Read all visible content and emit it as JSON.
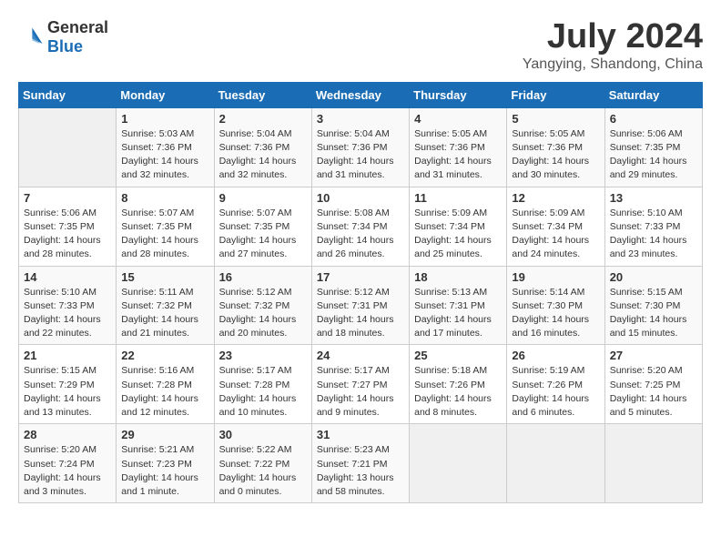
{
  "logo": {
    "line1": "General",
    "line2": "Blue"
  },
  "title": "July 2024",
  "location": "Yangying, Shandong, China",
  "headers": [
    "Sunday",
    "Monday",
    "Tuesday",
    "Wednesday",
    "Thursday",
    "Friday",
    "Saturday"
  ],
  "weeks": [
    [
      {
        "day": "",
        "info": ""
      },
      {
        "day": "1",
        "info": "Sunrise: 5:03 AM\nSunset: 7:36 PM\nDaylight: 14 hours\nand 32 minutes."
      },
      {
        "day": "2",
        "info": "Sunrise: 5:04 AM\nSunset: 7:36 PM\nDaylight: 14 hours\nand 32 minutes."
      },
      {
        "day": "3",
        "info": "Sunrise: 5:04 AM\nSunset: 7:36 PM\nDaylight: 14 hours\nand 31 minutes."
      },
      {
        "day": "4",
        "info": "Sunrise: 5:05 AM\nSunset: 7:36 PM\nDaylight: 14 hours\nand 31 minutes."
      },
      {
        "day": "5",
        "info": "Sunrise: 5:05 AM\nSunset: 7:36 PM\nDaylight: 14 hours\nand 30 minutes."
      },
      {
        "day": "6",
        "info": "Sunrise: 5:06 AM\nSunset: 7:35 PM\nDaylight: 14 hours\nand 29 minutes."
      }
    ],
    [
      {
        "day": "7",
        "info": "Sunrise: 5:06 AM\nSunset: 7:35 PM\nDaylight: 14 hours\nand 28 minutes."
      },
      {
        "day": "8",
        "info": "Sunrise: 5:07 AM\nSunset: 7:35 PM\nDaylight: 14 hours\nand 28 minutes."
      },
      {
        "day": "9",
        "info": "Sunrise: 5:07 AM\nSunset: 7:35 PM\nDaylight: 14 hours\nand 27 minutes."
      },
      {
        "day": "10",
        "info": "Sunrise: 5:08 AM\nSunset: 7:34 PM\nDaylight: 14 hours\nand 26 minutes."
      },
      {
        "day": "11",
        "info": "Sunrise: 5:09 AM\nSunset: 7:34 PM\nDaylight: 14 hours\nand 25 minutes."
      },
      {
        "day": "12",
        "info": "Sunrise: 5:09 AM\nSunset: 7:34 PM\nDaylight: 14 hours\nand 24 minutes."
      },
      {
        "day": "13",
        "info": "Sunrise: 5:10 AM\nSunset: 7:33 PM\nDaylight: 14 hours\nand 23 minutes."
      }
    ],
    [
      {
        "day": "14",
        "info": "Sunrise: 5:10 AM\nSunset: 7:33 PM\nDaylight: 14 hours\nand 22 minutes."
      },
      {
        "day": "15",
        "info": "Sunrise: 5:11 AM\nSunset: 7:32 PM\nDaylight: 14 hours\nand 21 minutes."
      },
      {
        "day": "16",
        "info": "Sunrise: 5:12 AM\nSunset: 7:32 PM\nDaylight: 14 hours\nand 20 minutes."
      },
      {
        "day": "17",
        "info": "Sunrise: 5:12 AM\nSunset: 7:31 PM\nDaylight: 14 hours\nand 18 minutes."
      },
      {
        "day": "18",
        "info": "Sunrise: 5:13 AM\nSunset: 7:31 PM\nDaylight: 14 hours\nand 17 minutes."
      },
      {
        "day": "19",
        "info": "Sunrise: 5:14 AM\nSunset: 7:30 PM\nDaylight: 14 hours\nand 16 minutes."
      },
      {
        "day": "20",
        "info": "Sunrise: 5:15 AM\nSunset: 7:30 PM\nDaylight: 14 hours\nand 15 minutes."
      }
    ],
    [
      {
        "day": "21",
        "info": "Sunrise: 5:15 AM\nSunset: 7:29 PM\nDaylight: 14 hours\nand 13 minutes."
      },
      {
        "day": "22",
        "info": "Sunrise: 5:16 AM\nSunset: 7:28 PM\nDaylight: 14 hours\nand 12 minutes."
      },
      {
        "day": "23",
        "info": "Sunrise: 5:17 AM\nSunset: 7:28 PM\nDaylight: 14 hours\nand 10 minutes."
      },
      {
        "day": "24",
        "info": "Sunrise: 5:17 AM\nSunset: 7:27 PM\nDaylight: 14 hours\nand 9 minutes."
      },
      {
        "day": "25",
        "info": "Sunrise: 5:18 AM\nSunset: 7:26 PM\nDaylight: 14 hours\nand 8 minutes."
      },
      {
        "day": "26",
        "info": "Sunrise: 5:19 AM\nSunset: 7:26 PM\nDaylight: 14 hours\nand 6 minutes."
      },
      {
        "day": "27",
        "info": "Sunrise: 5:20 AM\nSunset: 7:25 PM\nDaylight: 14 hours\nand 5 minutes."
      }
    ],
    [
      {
        "day": "28",
        "info": "Sunrise: 5:20 AM\nSunset: 7:24 PM\nDaylight: 14 hours\nand 3 minutes."
      },
      {
        "day": "29",
        "info": "Sunrise: 5:21 AM\nSunset: 7:23 PM\nDaylight: 14 hours\nand 1 minute."
      },
      {
        "day": "30",
        "info": "Sunrise: 5:22 AM\nSunset: 7:22 PM\nDaylight: 14 hours\nand 0 minutes."
      },
      {
        "day": "31",
        "info": "Sunrise: 5:23 AM\nSunset: 7:21 PM\nDaylight: 13 hours\nand 58 minutes."
      },
      {
        "day": "",
        "info": ""
      },
      {
        "day": "",
        "info": ""
      },
      {
        "day": "",
        "info": ""
      }
    ]
  ]
}
